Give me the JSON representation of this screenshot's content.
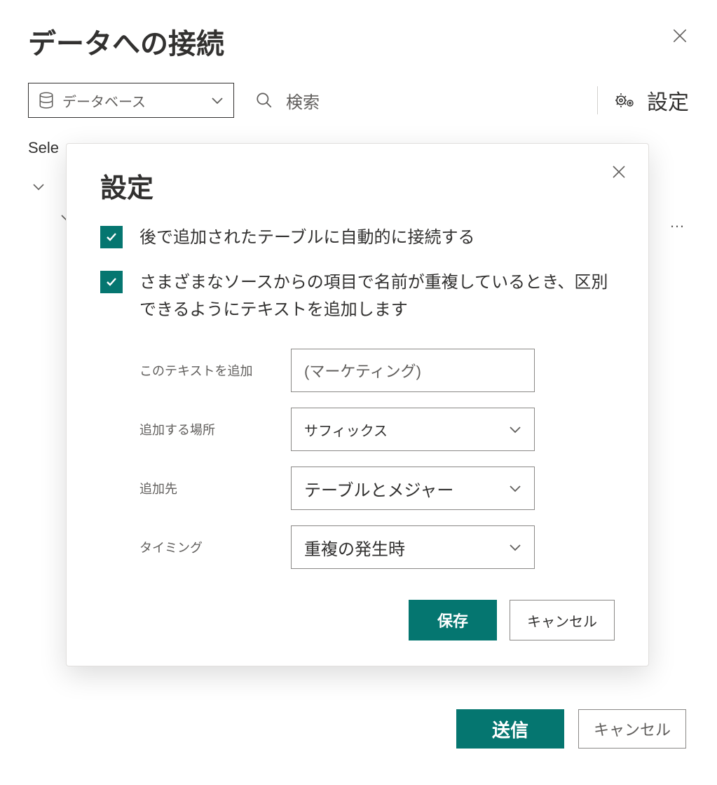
{
  "page": {
    "title": "データへの接続",
    "select_hint": "Sele",
    "ellipsis": "…"
  },
  "toolbar": {
    "source_dropdown": "データベース",
    "search_placeholder": "検索",
    "settings_label": "設定"
  },
  "footer": {
    "submit": "送信",
    "cancel": "キャンセル"
  },
  "modal": {
    "title": "設定",
    "checkbox1": "後で追加されたテーブルに自動的に接続する",
    "checkbox2": "さまざまなソースからの項目で名前が重複しているとき、区別できるようにテキストを追加します",
    "fields": {
      "add_text_label": "このテキストを追加",
      "add_text_value": "(マーケティング)",
      "location_label": "追加する場所",
      "location_value": "サフィックス",
      "target_label": "追加先",
      "target_value": "テーブルとメジャー",
      "timing_label": "タイミング",
      "timing_value": "重複の発生時"
    },
    "save": "保存",
    "cancel": "キャンセル"
  }
}
